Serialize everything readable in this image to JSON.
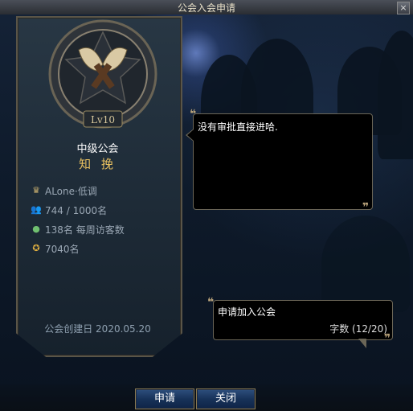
{
  "window": {
    "title": "公会入会申请",
    "close_label": "×"
  },
  "guild": {
    "level": "Lv10",
    "type": "中级公会",
    "name": "知 挽",
    "leader": "ALone·低调",
    "members": "744 / 1000名",
    "weekly_visitors": "138名 每周访客数",
    "points": "7040名",
    "founded": "公会创建日 2020.05.20"
  },
  "notice": {
    "text": "没有审批直接进哈."
  },
  "application": {
    "text": "申请加入公会",
    "char_count": "字数 (12/20)"
  },
  "buttons": {
    "apply": "申请",
    "close": "关闭"
  },
  "icons": {
    "leader": "crown-icon",
    "members": "members-icon",
    "visitors": "visitor-icon",
    "points": "medal-icon"
  },
  "colors": {
    "guild_name": "#e8c060",
    "panel_border": "#5a5548",
    "button_bg": "#173259"
  }
}
